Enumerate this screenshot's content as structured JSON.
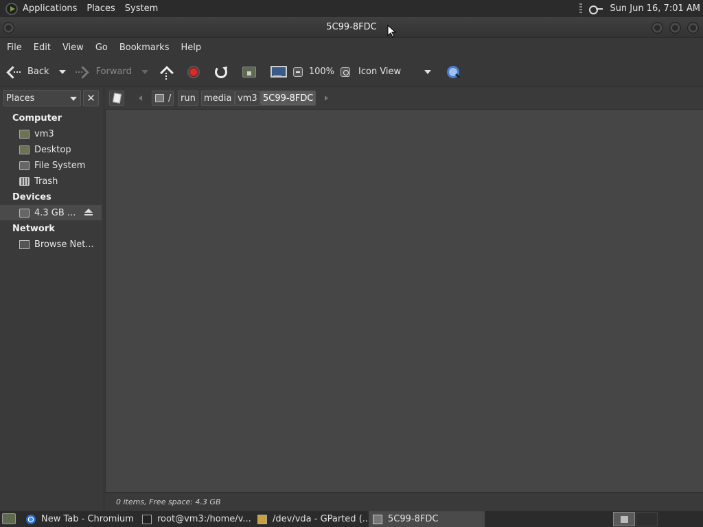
{
  "top_panel": {
    "menus": [
      "Applications",
      "Places",
      "System"
    ],
    "clock": "Sun Jun 16,  7:01 AM"
  },
  "window": {
    "title": "5C99-8FDC"
  },
  "menubar": [
    "File",
    "Edit",
    "View",
    "Go",
    "Bookmarks",
    "Help"
  ],
  "toolbar": {
    "back_label": "Back",
    "forward_label": "Forward",
    "zoom_level": "100%",
    "view_mode": "Icon View"
  },
  "sidebar": {
    "selector_label": "Places",
    "close_symbol": "✕",
    "sections": [
      {
        "heading": "Computer",
        "items": [
          {
            "label": "vm3",
            "icon": "home-folder-icon"
          },
          {
            "label": "Desktop",
            "icon": "desktop-folder-icon"
          },
          {
            "label": "File System",
            "icon": "filesystem-icon"
          },
          {
            "label": "Trash",
            "icon": "trash-icon"
          }
        ]
      },
      {
        "heading": "Devices",
        "items": [
          {
            "label": "4.3 GB ...",
            "icon": "drive-icon",
            "selected": true
          }
        ]
      },
      {
        "heading": "Network",
        "items": [
          {
            "label": "Browse Net...",
            "icon": "network-icon"
          }
        ]
      }
    ]
  },
  "location": {
    "crumbs": [
      "/",
      "run",
      "media",
      "vm3",
      "5C99-8FDC"
    ]
  },
  "status": {
    "text": "0 items, Free space: 4.3 GB"
  },
  "taskbar": {
    "tasks": [
      {
        "label": "New Tab - Chromium",
        "icon": "chromium-icon"
      },
      {
        "label": "root@vm3:/home/v...",
        "icon": "terminal-icon"
      },
      {
        "label": "/dev/vda - GParted (...",
        "icon": "gparted-icon"
      },
      {
        "label": "5C99-8FDC",
        "icon": "file-manager-icon",
        "active": true
      }
    ]
  }
}
